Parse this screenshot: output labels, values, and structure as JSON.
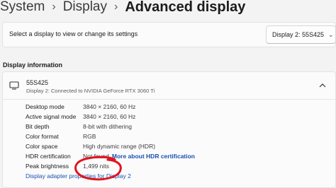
{
  "breadcrumb": {
    "items": [
      "System",
      "Display",
      "Advanced display"
    ],
    "separator": "›"
  },
  "display_selector": {
    "label": "Select a display to view or change its settings",
    "selected": "Display 2: 55S425",
    "chevron_icon": "chevron-down-icon"
  },
  "display_information": {
    "section_title": "Display information",
    "monitor_icon": "monitor-icon",
    "name": "55S425",
    "subtitle": "Display 2: Connected to NVIDIA GeForce RTX 3060 Ti",
    "collapse_icon": "chevron-up-icon",
    "rows": [
      {
        "label": "Desktop mode",
        "value": "3840 × 2160, 60 Hz"
      },
      {
        "label": "Active signal mode",
        "value": "3840 × 2160, 60 Hz"
      },
      {
        "label": "Bit depth",
        "value": "8-bit with dithering"
      },
      {
        "label": "Color format",
        "value": "RGB"
      },
      {
        "label": "Color space",
        "value": "High dynamic range (HDR)"
      },
      {
        "label": "HDR certification",
        "value": "Not found",
        "link": "More about HDR certification"
      },
      {
        "label": "Peak brightness",
        "value": "1,499 nits"
      }
    ],
    "adapter_link": "Display adapter properties for Display 2"
  },
  "colors": {
    "background": "#f3f3f3",
    "card": "#fbfbfb",
    "link": "#1a4fb0",
    "annotation": "#e0141e"
  }
}
